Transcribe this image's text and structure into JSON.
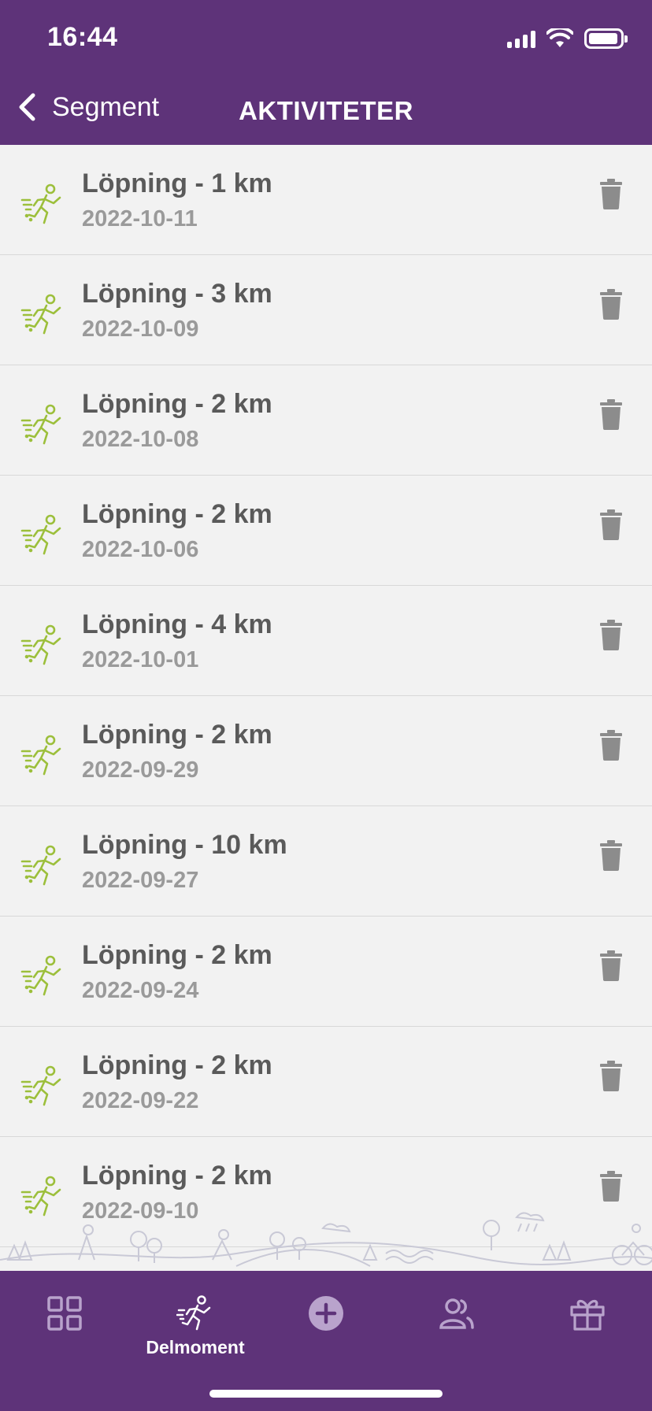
{
  "status_bar": {
    "time": "16:44"
  },
  "nav": {
    "back_label": "Segment",
    "title": "AKTIVITETER"
  },
  "activities": [
    {
      "title": "Löpning - 1 km",
      "date": "2022-10-11"
    },
    {
      "title": "Löpning - 3 km",
      "date": "2022-10-09"
    },
    {
      "title": "Löpning - 2 km",
      "date": "2022-10-08"
    },
    {
      "title": "Löpning - 2 km",
      "date": "2022-10-06"
    },
    {
      "title": "Löpning - 4 km",
      "date": "2022-10-01"
    },
    {
      "title": "Löpning - 2 km",
      "date": "2022-09-29"
    },
    {
      "title": "Löpning - 10 km",
      "date": "2022-09-27"
    },
    {
      "title": "Löpning - 2 km",
      "date": "2022-09-24"
    },
    {
      "title": "Löpning - 2 km",
      "date": "2022-09-22"
    },
    {
      "title": "Löpning - 2 km",
      "date": "2022-09-10"
    }
  ],
  "tabbar": {
    "items": [
      {
        "icon": "grid-icon",
        "label": ""
      },
      {
        "icon": "runner-icon",
        "label": "Delmoment",
        "active": true
      },
      {
        "icon": "plus-circle-icon",
        "label": ""
      },
      {
        "icon": "people-icon",
        "label": ""
      },
      {
        "icon": "gift-icon",
        "label": ""
      }
    ]
  },
  "colors": {
    "brand_purple": "#5e3379",
    "runner_green": "#9cbf3b",
    "trash_gray": "#8c8c8c",
    "tab_icon_inactive": "#b9a3cc"
  }
}
